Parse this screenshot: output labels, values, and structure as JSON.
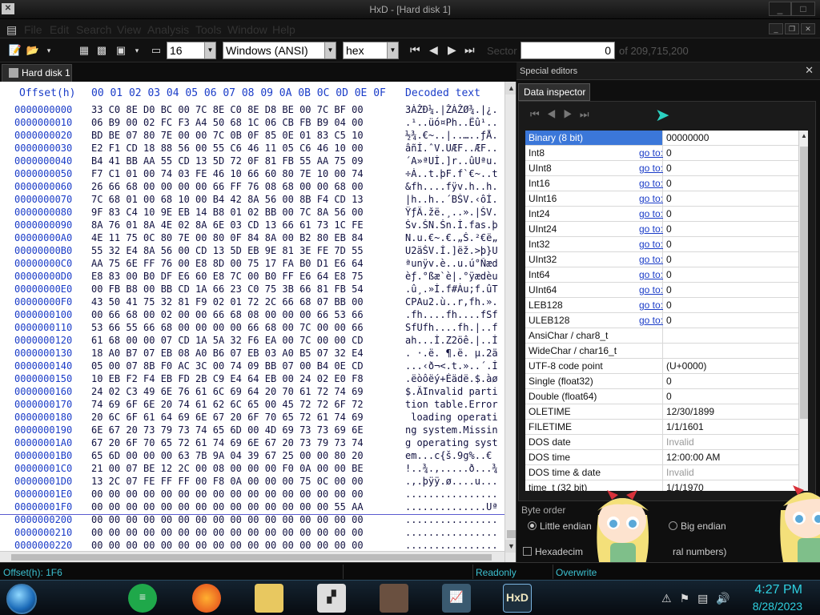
{
  "window": {
    "title": "HxD - [Hard disk 1]"
  },
  "menu": {
    "items": [
      "File",
      "Edit",
      "Search",
      "View",
      "Analysis",
      "Tools",
      "Window",
      "Help"
    ]
  },
  "toolbar": {
    "bytes_per_row": "16",
    "charset": "Windows (ANSI)",
    "offset_base": "hex",
    "sector_label": "Sector",
    "sector_value": "0",
    "sector_total": "of 209,715,200"
  },
  "tab": {
    "label": "Hard disk 1"
  },
  "hex": {
    "offset_header": "Offset(h)",
    "columns": [
      "00",
      "01",
      "02",
      "03",
      "04",
      "05",
      "06",
      "07",
      "08",
      "09",
      "0A",
      "0B",
      "0C",
      "0D",
      "0E",
      "0F"
    ],
    "decoded_header": "Decoded text",
    "rows": [
      {
        "offset": "0000000000",
        "bytes": "33 C0 8E D0 BC 00 7C 8E C0 8E D8 BE 00 7C BF 00",
        "text": "3ÀŽÐ¼.|ŽÀŽØ¾.|¿."
      },
      {
        "offset": "0000000010",
        "bytes": "06 B9 00 02 FC F3 A4 50 68 1C 06 CB FB B9 04 00",
        "text": ".¹..üó¤Ph..Ëû¹.."
      },
      {
        "offset": "0000000020",
        "bytes": "BD BE 07 80 7E 00 00 7C 0B 0F 85 0E 01 83 C5 10",
        "text": "½¾.€~..|..…..ƒÅ."
      },
      {
        "offset": "0000000030",
        "bytes": "E2 F1 CD 18 88 56 00 55 C6 46 11 05 C6 46 10 00",
        "text": "âñÍ.ˆV.UÆF..ÆF.."
      },
      {
        "offset": "0000000040",
        "bytes": "B4 41 BB AA 55 CD 13 5D 72 0F 81 FB 55 AA 75 09",
        "text": "´A»ªUÍ.]r..ûUªu."
      },
      {
        "offset": "0000000050",
        "bytes": "F7 C1 01 00 74 03 FE 46 10 66 60 80 7E 10 00 74",
        "text": "÷Á..t.þF.f`€~..t"
      },
      {
        "offset": "0000000060",
        "bytes": "26 66 68 00 00 00 00 66 FF 76 08 68 00 00 68 00",
        "text": "&fh....fÿv.h..h."
      },
      {
        "offset": "0000000070",
        "bytes": "7C 68 01 00 68 10 00 B4 42 8A 56 00 8B F4 CD 13",
        "text": "|h..h..´BŠV.‹ôÍ."
      },
      {
        "offset": "0000000080",
        "bytes": "9F 83 C4 10 9E EB 14 B8 01 02 BB 00 7C 8A 56 00",
        "text": "ŸƒÄ.žë.¸..».|ŠV."
      },
      {
        "offset": "0000000090",
        "bytes": "8A 76 01 8A 4E 02 8A 6E 03 CD 13 66 61 73 1C FE",
        "text": "Šv.ŠN.Šn.Í.fas.þ"
      },
      {
        "offset": "00000000A0",
        "bytes": "4E 11 75 0C 80 7E 00 80 0F 84 8A 00 B2 80 EB 84",
        "text": "N.u.€~.€.„Š.²€ë„"
      },
      {
        "offset": "00000000B0",
        "bytes": "55 32 E4 8A 56 00 CD 13 5D EB 9E 81 3E FE 7D 55",
        "text": "U2äŠV.Í.]ëž.>þ}U"
      },
      {
        "offset": "00000000C0",
        "bytes": "AA 75 6E FF 76 00 E8 8D 00 75 17 FA B0 D1 E6 64",
        "text": "ªunÿv.è..u.ú°Ñæd"
      },
      {
        "offset": "00000000D0",
        "bytes": "E8 83 00 B0 DF E6 60 E8 7C 00 B0 FF E6 64 E8 75",
        "text": "èƒ.°ßæ`è|.°ÿædèu"
      },
      {
        "offset": "00000000E0",
        "bytes": "00 FB B8 00 BB CD 1A 66 23 C0 75 3B 66 81 FB 54",
        "text": ".û¸.»Í.f#Àu;f.ûT"
      },
      {
        "offset": "00000000F0",
        "bytes": "43 50 41 75 32 81 F9 02 01 72 2C 66 68 07 BB 00",
        "text": "CPAu2.ù..r,fh.»."
      },
      {
        "offset": "0000000100",
        "bytes": "00 66 68 00 02 00 00 66 68 08 00 00 00 66 53 66",
        "text": ".fh....fh....fSf"
      },
      {
        "offset": "0000000110",
        "bytes": "53 66 55 66 68 00 00 00 00 66 68 00 7C 00 00 66",
        "text": "SfUfh....fh.|..f"
      },
      {
        "offset": "0000000120",
        "bytes": "61 68 00 00 07 CD 1A 5A 32 F6 EA 00 7C 00 00 CD",
        "text": "ah...Í.Z2öê.|..Í"
      },
      {
        "offset": "0000000130",
        "bytes": "18 A0 B7 07 EB 08 A0 B6 07 EB 03 A0 B5 07 32 E4",
        "text": ". ·.ë. ¶.ë. µ.2ä"
      },
      {
        "offset": "0000000140",
        "bytes": "05 00 07 8B F0 AC 3C 00 74 09 BB 07 00 B4 0E CD",
        "text": "...‹ð¬<.t.»..´.Í"
      },
      {
        "offset": "0000000150",
        "bytes": "10 EB F2 F4 EB FD 2B C9 E4 64 EB 00 24 02 E0 F8",
        "text": ".ëòôëý+Éädë.$.àø"
      },
      {
        "offset": "0000000160",
        "bytes": "24 02 C3 49 6E 76 61 6C 69 64 20 70 61 72 74 69",
        "text": "$.ÃInvalid parti"
      },
      {
        "offset": "0000000170",
        "bytes": "74 69 6F 6E 20 74 61 62 6C 65 00 45 72 72 6F 72",
        "text": "tion table.Error"
      },
      {
        "offset": "0000000180",
        "bytes": "20 6C 6F 61 64 69 6E 67 20 6F 70 65 72 61 74 69",
        "text": " loading operati"
      },
      {
        "offset": "0000000190",
        "bytes": "6E 67 20 73 79 73 74 65 6D 00 4D 69 73 73 69 6E",
        "text": "ng system.Missin"
      },
      {
        "offset": "00000001A0",
        "bytes": "67 20 6F 70 65 72 61 74 69 6E 67 20 73 79 73 74",
        "text": "g operating syst"
      },
      {
        "offset": "00000001B0",
        "bytes": "65 6D 00 00 00 63 7B 9A 04 39 67 25 00 00 80 20",
        "text": "em...c{š.9g%..€ "
      },
      {
        "offset": "00000001C0",
        "bytes": "21 00 07 BE 12 2C 00 08 00 00 00 F0 0A 00 00 BE",
        "text": "!..¾.,.....ð...¾"
      },
      {
        "offset": "00000001D0",
        "bytes": "13 2C 07 FE FF FF 00 F8 0A 00 00 00 75 0C 00 00",
        "text": ".,.þÿÿ.ø....u..."
      },
      {
        "offset": "00000001E0",
        "bytes": "00 00 00 00 00 00 00 00 00 00 00 00 00 00 00 00",
        "text": "................"
      },
      {
        "offset": "00000001F0",
        "bytes": "00 00 00 00 00 00 00 00 00 00 00 00 00 00 55 AA",
        "text": "..............Uª"
      },
      {
        "offset": "0000000200",
        "bytes": "00 00 00 00 00 00 00 00 00 00 00 00 00 00 00 00",
        "text": "................"
      },
      {
        "offset": "0000000210",
        "bytes": "00 00 00 00 00 00 00 00 00 00 00 00 00 00 00 00",
        "text": "................"
      },
      {
        "offset": "0000000220",
        "bytes": "00 00 00 00 00 00 00 00 00 00 00 00 00 00 00 00",
        "text": "................"
      }
    ]
  },
  "panel": {
    "title": "Special editors",
    "tab": "Data inspector",
    "goto": "go to:",
    "rows": [
      {
        "name": "Binary (8 bit)",
        "value": "00000000",
        "goto": false,
        "selected": true,
        "dim": false
      },
      {
        "name": "Int8",
        "value": "0",
        "goto": true,
        "selected": false,
        "dim": false
      },
      {
        "name": "UInt8",
        "value": "0",
        "goto": true,
        "selected": false,
        "dim": false
      },
      {
        "name": "Int16",
        "value": "0",
        "goto": true,
        "selected": false,
        "dim": false
      },
      {
        "name": "UInt16",
        "value": "0",
        "goto": true,
        "selected": false,
        "dim": false
      },
      {
        "name": "Int24",
        "value": "0",
        "goto": true,
        "selected": false,
        "dim": false
      },
      {
        "name": "UInt24",
        "value": "0",
        "goto": true,
        "selected": false,
        "dim": false
      },
      {
        "name": "Int32",
        "value": "0",
        "goto": true,
        "selected": false,
        "dim": false
      },
      {
        "name": "UInt32",
        "value": "0",
        "goto": true,
        "selected": false,
        "dim": false
      },
      {
        "name": "Int64",
        "value": "0",
        "goto": true,
        "selected": false,
        "dim": false
      },
      {
        "name": "UInt64",
        "value": "0",
        "goto": true,
        "selected": false,
        "dim": false
      },
      {
        "name": "LEB128",
        "value": "0",
        "goto": true,
        "selected": false,
        "dim": false
      },
      {
        "name": "ULEB128",
        "value": "0",
        "goto": true,
        "selected": false,
        "dim": false
      },
      {
        "name": "AnsiChar / char8_t",
        "value": "",
        "goto": false,
        "selected": false,
        "dim": false
      },
      {
        "name": "WideChar / char16_t",
        "value": "",
        "goto": false,
        "selected": false,
        "dim": false
      },
      {
        "name": "UTF-8 code point",
        "value": "  (U+0000)",
        "goto": false,
        "selected": false,
        "dim": false
      },
      {
        "name": "Single (float32)",
        "value": "0",
        "goto": false,
        "selected": false,
        "dim": false
      },
      {
        "name": "Double (float64)",
        "value": "0",
        "goto": false,
        "selected": false,
        "dim": false
      },
      {
        "name": "OLETIME",
        "value": "12/30/1899",
        "goto": false,
        "selected": false,
        "dim": false
      },
      {
        "name": "FILETIME",
        "value": "1/1/1601",
        "goto": false,
        "selected": false,
        "dim": false
      },
      {
        "name": "DOS date",
        "value": "Invalid",
        "goto": false,
        "selected": false,
        "dim": true
      },
      {
        "name": "DOS time",
        "value": "12:00:00 AM",
        "goto": false,
        "selected": false,
        "dim": false
      },
      {
        "name": "DOS time & date",
        "value": "Invalid",
        "goto": false,
        "selected": false,
        "dim": true
      },
      {
        "name": "time_t (32 bit)",
        "value": "1/1/1970",
        "goto": false,
        "selected": false,
        "dim": false
      }
    ],
    "byte_order_label": "Byte order",
    "little_endian": "Little endian",
    "big_endian": "Big endian",
    "hex_label": "Hexadecim",
    "hex_label_tail": "ral numbers)"
  },
  "status": {
    "offset": "Offset(h): 1F6",
    "mode": "Readonly",
    "insert": "Overwrite"
  },
  "taskbar": {
    "time": "4:27 PM",
    "date": "8/28/2023"
  },
  "colors": {
    "accent": "#2fd0e0",
    "hex_text": "#1a3cc8",
    "selection": "#3b77d9"
  }
}
